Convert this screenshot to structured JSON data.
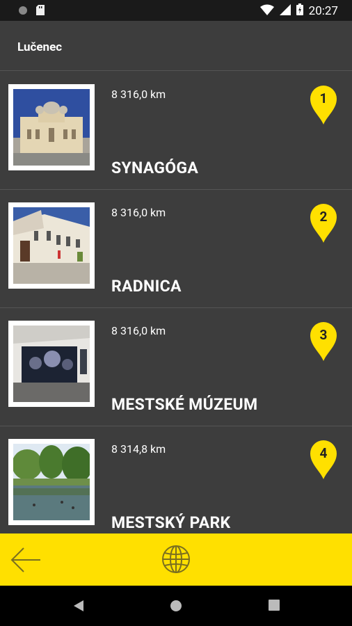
{
  "status_bar": {
    "time": "20:27",
    "icons": [
      "record-icon",
      "sd-card-icon",
      "wifi-icon",
      "signal-icon",
      "battery-icon"
    ]
  },
  "header": {
    "title": "Lučenec"
  },
  "places": [
    {
      "number": "1",
      "distance": "8 316,0 km",
      "name": "SYNAGÓGA"
    },
    {
      "number": "2",
      "distance": "8 316,0 km",
      "name": "RADNICA"
    },
    {
      "number": "3",
      "distance": "8 316,0 km",
      "name": "MESTSKÉ MÚZEUM"
    },
    {
      "number": "4",
      "distance": "8 314,8 km",
      "name": "MESTSKÝ PARK"
    }
  ],
  "bottom_bar": {
    "icons": [
      "back-arrow-icon",
      "globe-icon"
    ]
  },
  "nav_bar": {
    "icons": [
      "nav-back-icon",
      "nav-home-icon",
      "nav-recents-icon"
    ]
  },
  "colors": {
    "accent": "#ffe000",
    "background": "#3d3d3d",
    "status_bar": "#1a1a1a"
  }
}
